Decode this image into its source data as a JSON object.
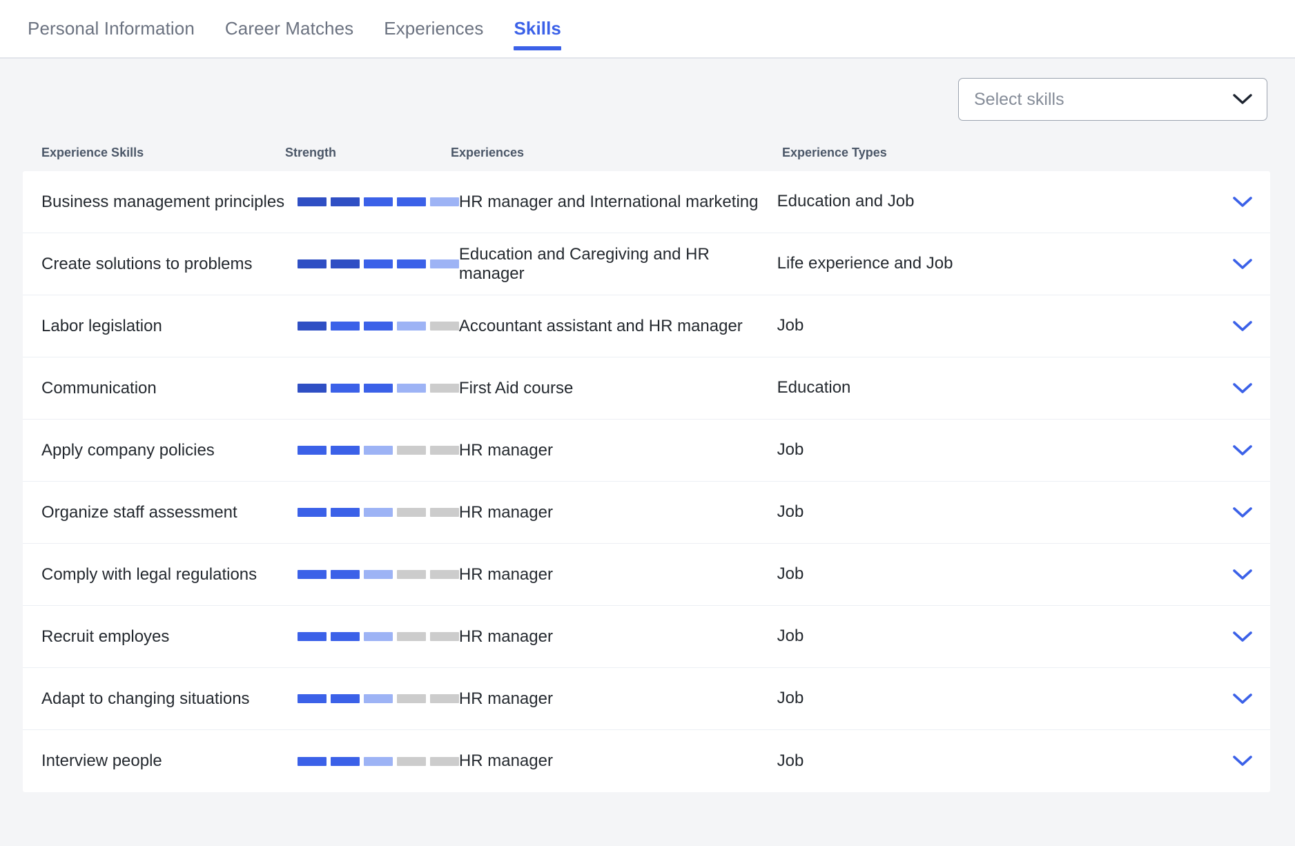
{
  "tabs": [
    {
      "label": "Personal Information",
      "active": false
    },
    {
      "label": "Career Matches",
      "active": false
    },
    {
      "label": "Experiences",
      "active": false
    },
    {
      "label": "Skills",
      "active": true
    }
  ],
  "select": {
    "placeholder": "Select skills",
    "icon": "chevron-down-icon"
  },
  "table": {
    "headers": {
      "skill": "Experience Skills",
      "strength": "Strength",
      "experiences": "Experiences",
      "types": "Experience Types"
    },
    "row_expand_icon": "chevron-down-icon",
    "rows": [
      {
        "skill": "Business management principles",
        "strength": [
          3,
          3,
          2,
          2,
          1
        ],
        "experiences": "HR manager and International marketing",
        "type": "Education and Job"
      },
      {
        "skill": "Create solutions to problems",
        "strength": [
          3,
          3,
          2,
          2,
          1
        ],
        "experiences": "Education and Caregiving and HR manager",
        "type": "Life experience and Job"
      },
      {
        "skill": "Labor legislation",
        "strength": [
          3,
          2,
          2,
          1,
          0
        ],
        "experiences": "Accountant assistant and HR manager",
        "type": "Job"
      },
      {
        "skill": "Communication",
        "strength": [
          3,
          2,
          2,
          1,
          0
        ],
        "experiences": "First Aid course",
        "type": "Education"
      },
      {
        "skill": "Apply company policies",
        "strength": [
          2,
          2,
          1,
          0,
          0
        ],
        "experiences": "HR manager",
        "type": "Job"
      },
      {
        "skill": "Organize staff assessment",
        "strength": [
          2,
          2,
          1,
          0,
          0
        ],
        "experiences": "HR manager",
        "type": "Job"
      },
      {
        "skill": "Comply with legal regulations",
        "strength": [
          2,
          2,
          1,
          0,
          0
        ],
        "experiences": "HR manager",
        "type": "Job"
      },
      {
        "skill": "Recruit employes",
        "strength": [
          2,
          2,
          1,
          0,
          0
        ],
        "experiences": "HR manager",
        "type": "Job"
      },
      {
        "skill": "Adapt to changing situations",
        "strength": [
          2,
          2,
          1,
          0,
          0
        ],
        "experiences": "HR manager",
        "type": "Job"
      },
      {
        "skill": "Interview people",
        "strength": [
          2,
          2,
          1,
          0,
          0
        ],
        "experiences": "HR manager",
        "type": "Job"
      }
    ]
  },
  "colors": {
    "accent": "#3b61e8",
    "strength_high": "#2f4fc4",
    "strength_mid": "#3b61e8",
    "strength_low": "#9db3f5",
    "strength_empty": "#cccccc",
    "page_bg": "#f4f5f7"
  }
}
